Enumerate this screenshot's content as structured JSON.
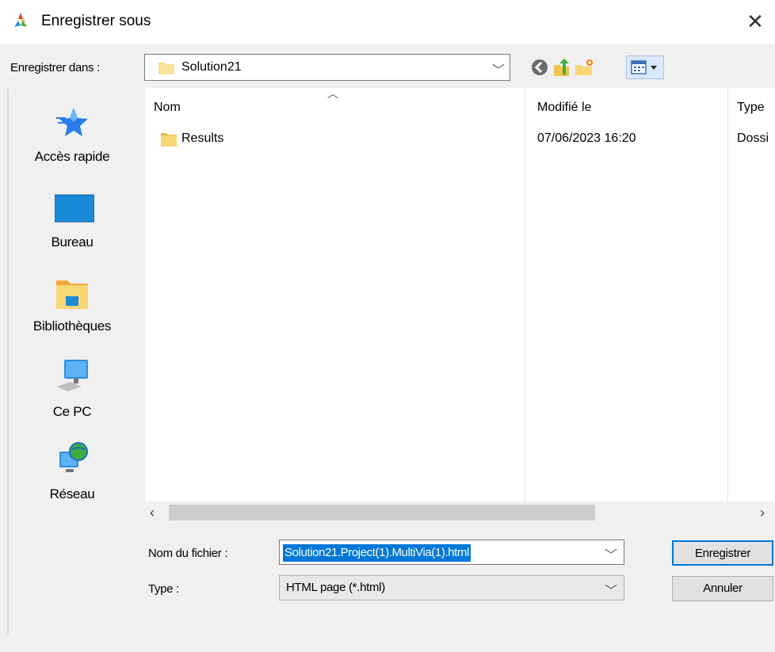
{
  "window": {
    "title": "Enregistrer sous",
    "close_glyph": "✕"
  },
  "toolbar": {
    "save_in_label": "Enregistrer dans :",
    "save_in_value": "Solution21",
    "icons": [
      "back-icon",
      "up-folder-icon",
      "new-folder-icon",
      "view-menu-icon"
    ]
  },
  "places": [
    {
      "label": "Accès rapide",
      "icon": "quick-access-star-icon"
    },
    {
      "label": "Bureau",
      "icon": "desktop-icon"
    },
    {
      "label": "Bibliothèques",
      "icon": "libraries-icon"
    },
    {
      "label": "Ce PC",
      "icon": "computer-icon"
    },
    {
      "label": "Réseau",
      "icon": "network-icon"
    }
  ],
  "filelist": {
    "columns": {
      "name": "Nom",
      "date": "Modifié le",
      "type": "Type"
    },
    "rows": [
      {
        "name": "Results",
        "date": "07/06/2023 16:20",
        "type": "Dossi"
      }
    ]
  },
  "scroll": {
    "left": "‹",
    "right": "›"
  },
  "form": {
    "filename_label": "Nom du fichier :",
    "filename_value": "Solution21.Project(1).MultiVia(1).html",
    "type_label": "Type :",
    "type_value": "HTML page (*.html)"
  },
  "buttons": {
    "save": "Enregistrer",
    "cancel": "Annuler"
  },
  "colors": {
    "accent": "#0078d7",
    "folder": "#f8d775",
    "star": "#2b7de9"
  }
}
